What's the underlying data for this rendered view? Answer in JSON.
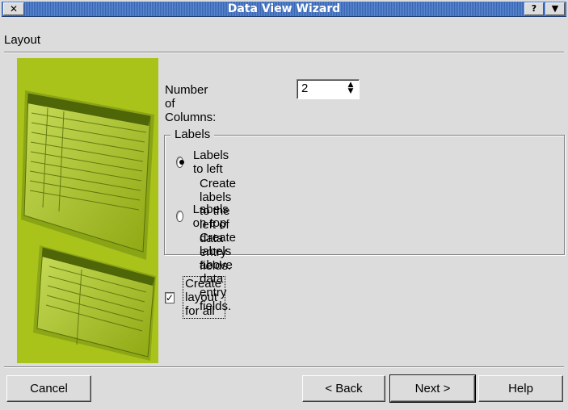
{
  "window": {
    "title": "Data View Wizard",
    "close_glyph": "✕",
    "help_glyph": "?",
    "menu_glyph": "▼"
  },
  "page": {
    "section": "Layout"
  },
  "columns": {
    "label": "Number of Columns:",
    "value": "2"
  },
  "labels_group": {
    "title": "Labels",
    "options": [
      {
        "label": "Labels to left",
        "description": "Create labels to the left of data entry fields.",
        "selected": true
      },
      {
        "label": "Labels on top",
        "description": "Create labels above data entry fields.",
        "selected": false
      }
    ]
  },
  "layout_all": {
    "label": "Create layout for all",
    "checked": true
  },
  "buttons": {
    "cancel": "Cancel",
    "back": "< Back",
    "next": "Next >",
    "help": "Help"
  },
  "colors": {
    "illustration_bg": "#a9c31b",
    "titlebar": "#3a67b3"
  },
  "icons": {
    "illustration": "form-sheets-illustration"
  }
}
